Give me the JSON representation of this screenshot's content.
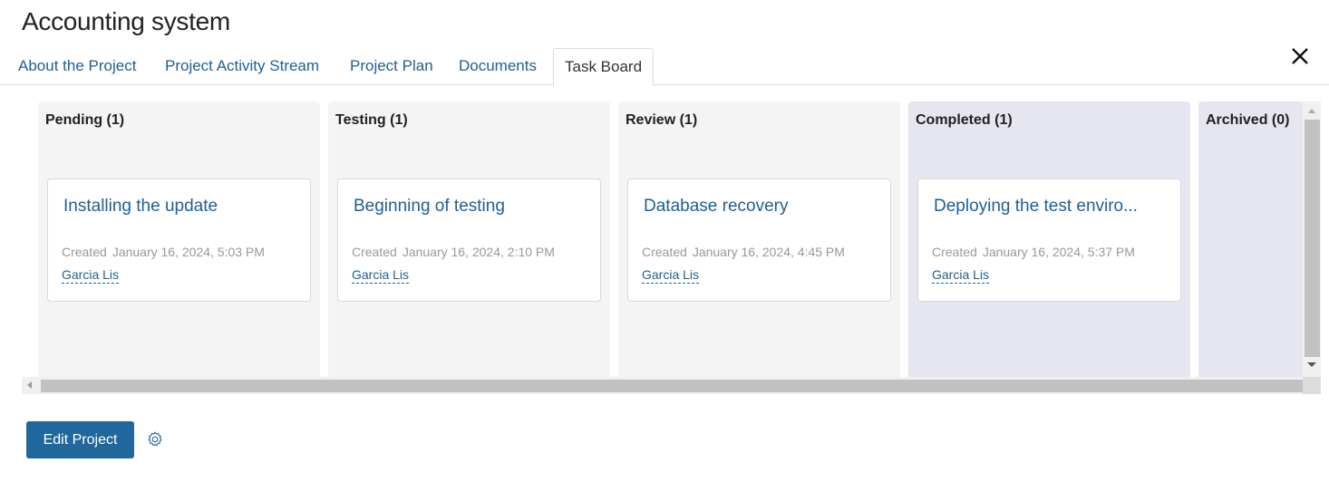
{
  "header": {
    "title": "Accounting system",
    "close_icon": "close-icon"
  },
  "tabs": [
    {
      "label": "About the Project",
      "active": false
    },
    {
      "label": "Project Activity Stream",
      "active": false
    },
    {
      "label": "Project Plan",
      "active": false
    },
    {
      "label": "Documents",
      "active": false
    },
    {
      "label": "Task Board",
      "active": true
    }
  ],
  "board": {
    "columns": [
      {
        "title": "Pending (1)",
        "tone": "gray",
        "cards": [
          {
            "title": "Installing the update",
            "created_label": "Created",
            "created": "January 16, 2024, 5:03 PM",
            "user": "Garcia Lis"
          }
        ]
      },
      {
        "title": "Testing (1)",
        "tone": "gray",
        "cards": [
          {
            "title": "Beginning of testing",
            "created_label": "Created",
            "created": "January 16, 2024, 2:10 PM",
            "user": "Garcia Lis"
          }
        ]
      },
      {
        "title": "Review (1)",
        "tone": "gray",
        "cards": [
          {
            "title": "Database recovery",
            "created_label": "Created",
            "created": "January 16, 2024, 4:45 PM",
            "user": "Garcia Lis"
          }
        ]
      },
      {
        "title": "Completed (1)",
        "tone": "lavender",
        "cards": [
          {
            "title": "Deploying the test enviro...",
            "created_label": "Created",
            "created": "January 16, 2024, 5:37 PM",
            "user": "Garcia Lis"
          }
        ]
      },
      {
        "title": "Archived (0)",
        "tone": "lavender",
        "cards": []
      }
    ]
  },
  "footer": {
    "edit_label": "Edit Project",
    "settings_icon": "gear-icon"
  },
  "colors": {
    "accent": "#20679b",
    "link": "#1f5f91",
    "column_gray": "#f4f4f4",
    "column_lavender": "#e6e6f1"
  }
}
